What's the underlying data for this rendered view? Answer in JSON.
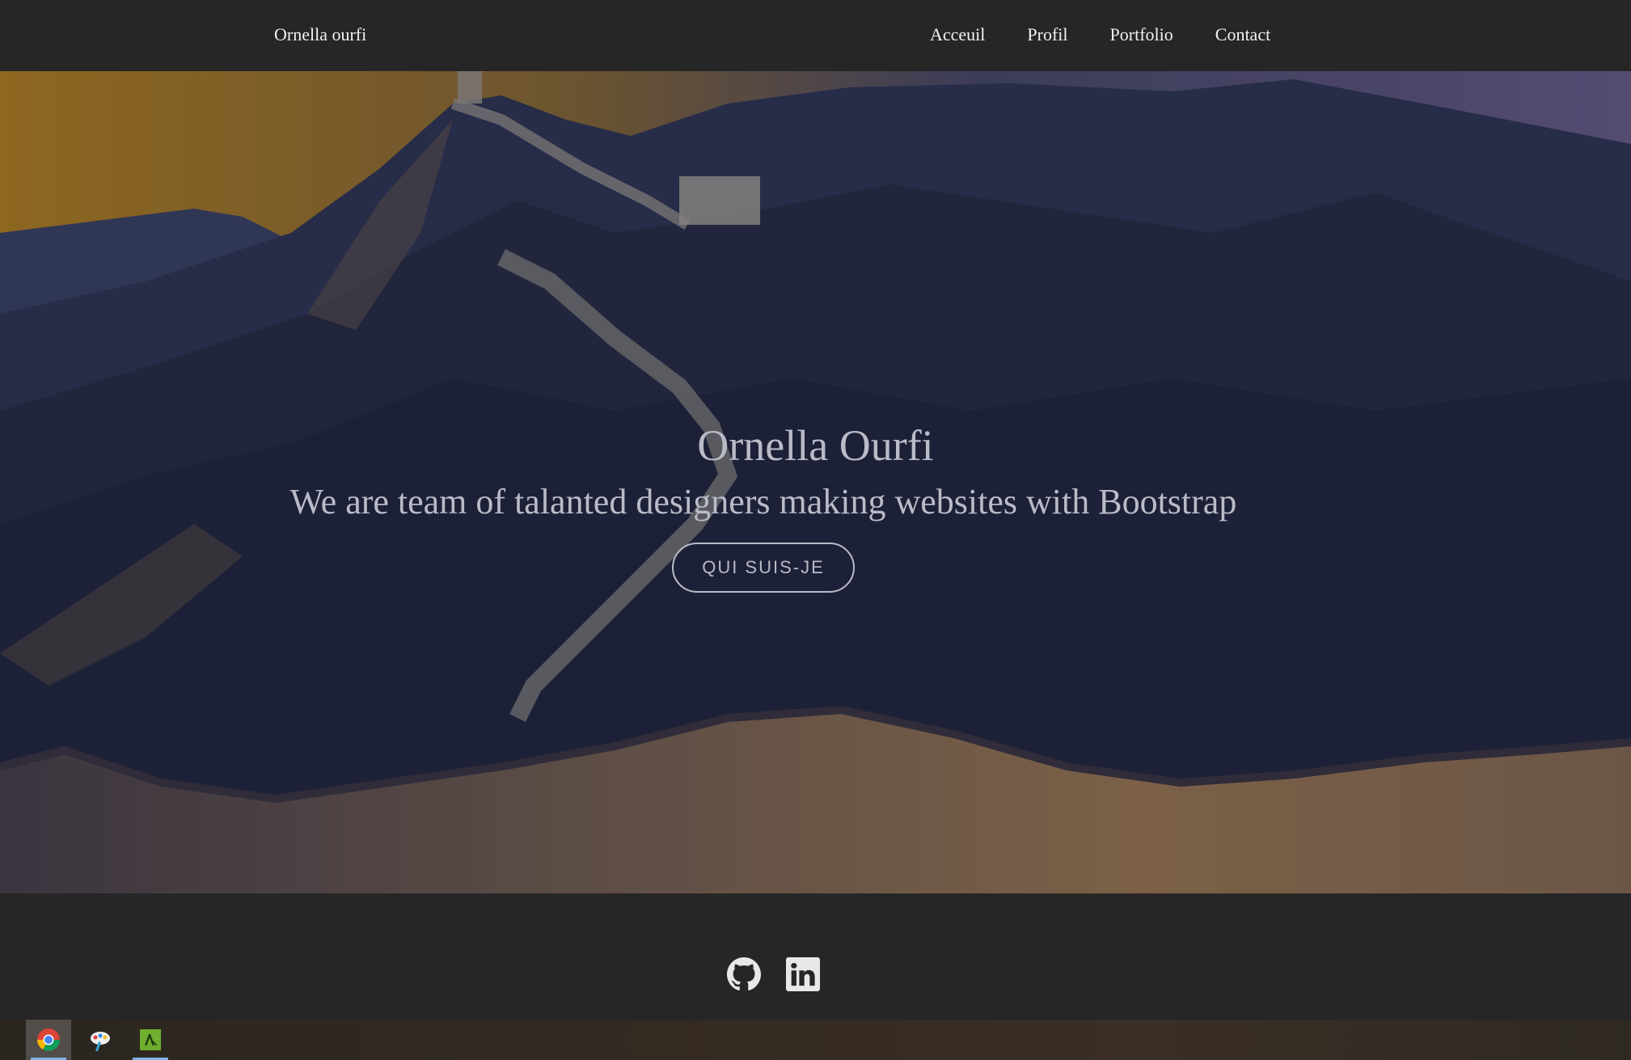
{
  "navbar": {
    "brand": "Ornella ourfi",
    "links": [
      "Acceuil",
      "Profil",
      "Portfolio",
      "Contact"
    ]
  },
  "hero": {
    "title": "Ornella Ourfi",
    "subtitle": "We are team of talanted designers making websites with Bootstrap",
    "button_label": "QUI SUIS-JE"
  },
  "footer": {
    "icons": [
      "github-icon",
      "linkedin-icon"
    ]
  },
  "taskbar": {
    "icons": [
      "file-explorer-icon",
      "chrome-icon",
      "paint-icon",
      "app-icon"
    ]
  },
  "colors": {
    "navbar_bg": "#262626",
    "hero_text": "#b9bbc7",
    "sky_gold": "#b9841f",
    "taskbar_accent": "#7fb2e5"
  }
}
